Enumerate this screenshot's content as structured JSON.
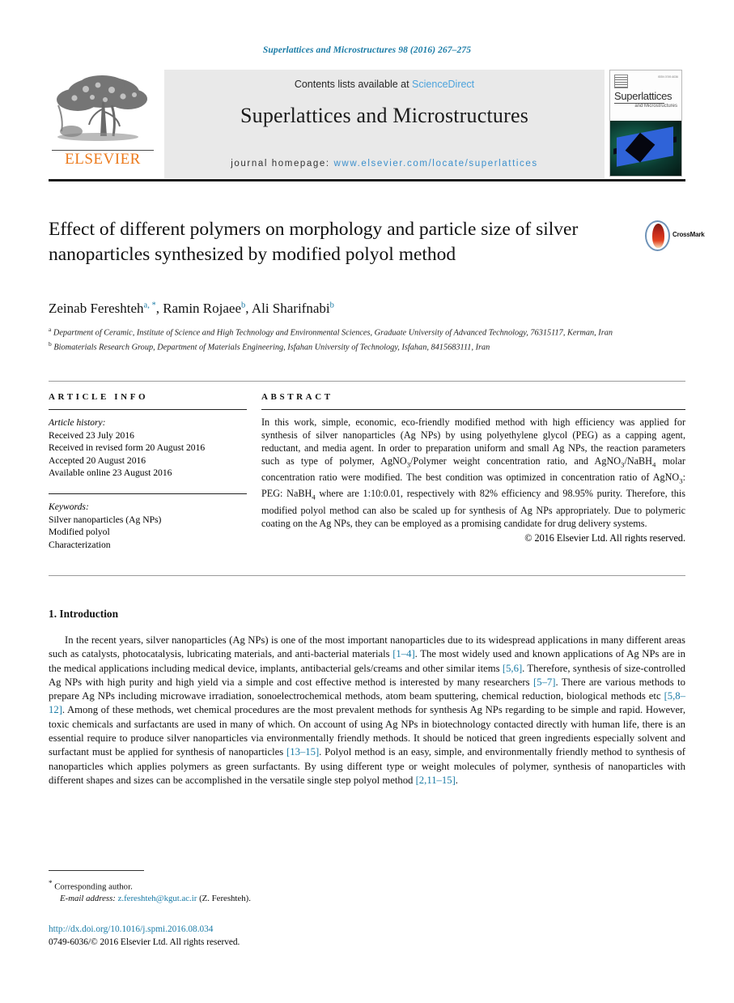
{
  "running_head": "Superlattices and Microstructures 98 (2016) 267–275",
  "masthead": {
    "contents_prefix": "Contents lists available at ",
    "contents_link": "ScienceDirect",
    "journal_title": "Superlattices and Microstructures",
    "homepage_prefix": "journal homepage: ",
    "homepage_url": "www.elsevier.com/locate/superlattices",
    "publisher": "ELSEVIER",
    "cover": {
      "title": "Superlattices",
      "subtitle": "and Microstructures"
    },
    "accent_link_color": "#4ca3dd",
    "accent_header_color": "#1a7ba6"
  },
  "article": {
    "title": "Effect of different polymers on morphology and particle size of silver nanoparticles synthesized by modified polyol method",
    "crossmark_label": "CrossMark",
    "authors": [
      {
        "name": "Zeinab Fereshteh",
        "marks": "a, *"
      },
      {
        "name": "Ramin Rojaee",
        "marks": "b"
      },
      {
        "name": "Ali Sharifnabi",
        "marks": "b"
      }
    ],
    "authors_line": "Zeinab Fereshteh a, *, Ramin Rojaee b, Ali Sharifnabi b",
    "affiliations": [
      {
        "mark": "a",
        "text": "Department of Ceramic, Institute of Science and High Technology and Environmental Sciences, Graduate University of Advanced Technology, 76315117, Kerman, Iran"
      },
      {
        "mark": "b",
        "text": "Biomaterials Research Group, Department of Materials Engineering, Isfahan University of Technology, Isfahan, 8415683111, Iran"
      }
    ]
  },
  "info": {
    "heading": "ARTICLE INFO",
    "history_title": "Article history:",
    "history": [
      "Received 23 July 2016",
      "Received in revised form 20 August 2016",
      "Accepted 20 August 2016",
      "Available online 23 August 2016"
    ],
    "keywords_title": "Keywords:",
    "keywords": [
      "Silver nanoparticles (Ag NPs)",
      "Modified polyol",
      "Characterization"
    ]
  },
  "abstract": {
    "heading": "ABSTRACT",
    "body": "In this work, simple, economic, eco-friendly modified method with high efficiency was applied for synthesis of silver nanoparticles (Ag NPs) by using polyethylene glycol (PEG) as a capping agent, reductant, and media agent. In order to preparation uniform and small Ag NPs, the reaction parameters such as type of polymer, AgNO3/Polymer weight concentration ratio, and AgNO3/NaBH4 molar concentration ratio were modified. The best condition was optimized in concentration ratio of AgNO3: PEG: NaBH4 where are 1:10:0.01, respectively with 82% efficiency and 98.95% purity. Therefore, this modified polyol method can also be scaled up for synthesis of Ag NPs appropriately. Due to polymeric coating on the Ag NPs, they can be employed as a promising candidate for drug delivery systems.",
    "copyright": "© 2016 Elsevier Ltd. All rights reserved."
  },
  "introduction": {
    "number_title": "1. Introduction",
    "paragraph": "In the recent years, silver nanoparticles (Ag NPs) is one of the most important nanoparticles due to its widespread applications in many different areas such as catalysts, photocatalysis, lubricating materials, and anti-bacterial materials [1–4]. The most widely used and known applications of Ag NPs are in the medical applications including medical device, implants, antibacterial gels/creams and other similar items [5,6]. Therefore, synthesis of size-controlled Ag NPs with high purity and high yield via a simple and cost effective method is interested by many researchers [5–7]. There are various methods to prepare Ag NPs including microwave irradiation, sonoelectrochemical methods, atom beam sputtering, chemical reduction, biological methods etc [5,8–12]. Among of these methods, wet chemical procedures are the most prevalent methods for synthesis Ag NPs regarding to be simple and rapid. However, toxic chemicals and surfactants are used in many of which. On account of using Ag NPs in biotechnology contacted directly with human life, there is an essential require to produce silver nanoparticles via environmentally friendly methods. It should be noticed that green ingredients especially solvent and surfactant must be applied for synthesis of nanoparticles [13–15]. Polyol method is an easy, simple, and environmentally friendly method to synthesis of nanoparticles which applies polymers as green surfactants. By using different type or weight molecules of polymer, synthesis of nanoparticles with different shapes and sizes can be accomplished in the versatile single step polyol method [2,11–15].",
    "citations": [
      "[1–4]",
      "[5,6]",
      "[5–7]",
      "[5,8–12]",
      "[13–15]",
      "[2,11–15]"
    ]
  },
  "footer": {
    "corresponding_author": "Corresponding author.",
    "email_label": "E-mail address:",
    "email": "z.fereshteh@kgut.ac.ir",
    "email_owner": "(Z. Fereshteh).",
    "doi": "http://dx.doi.org/10.1016/j.spmi.2016.08.034",
    "issn_line": "0749-6036/© 2016 Elsevier Ltd. All rights reserved."
  }
}
